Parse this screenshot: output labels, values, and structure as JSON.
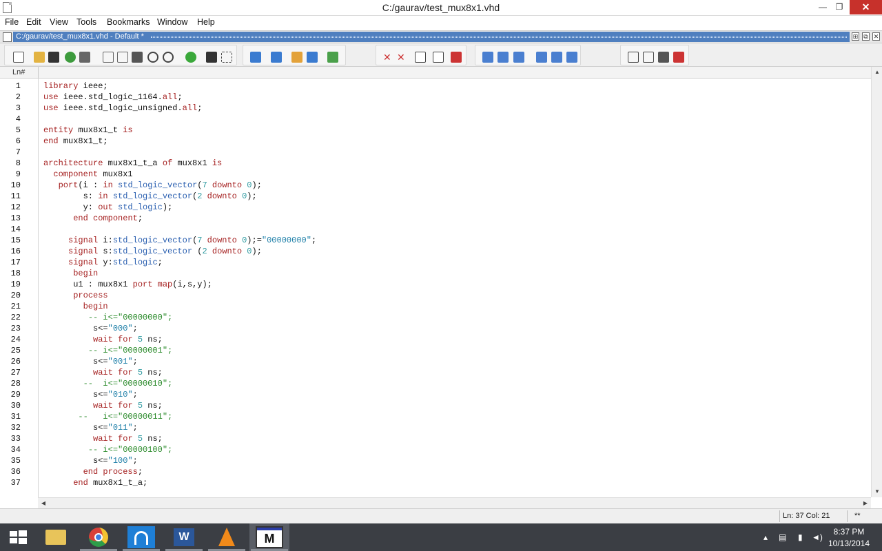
{
  "window": {
    "title": "C:/gaurav/test_mux8x1.vhd",
    "minimize_glyph": "—",
    "maximize_glyph": "❐",
    "close_glyph": "✕"
  },
  "menu": [
    "File",
    "Edit",
    "View",
    "Tools",
    "Bookmarks",
    "Window",
    "Help"
  ],
  "tab": {
    "label": "C:/gaurav/test_mux8x1.vhd - Default *",
    "active_color": "#4f7fbf"
  },
  "ruler": {
    "label": "Ln#"
  },
  "code": [
    {
      "n": "1",
      "seg": [
        [
          "kw",
          "library"
        ],
        [
          "tx",
          " ieee;"
        ]
      ]
    },
    {
      "n": "2",
      "seg": [
        [
          "kw",
          "use"
        ],
        [
          "tx",
          " ieee.std_logic_1164."
        ],
        [
          "kw",
          "all"
        ],
        [
          "tx",
          ";"
        ]
      ]
    },
    {
      "n": "3",
      "seg": [
        [
          "kw",
          "use"
        ],
        [
          "tx",
          " ieee.std_logic_unsigned."
        ],
        [
          "kw",
          "all"
        ],
        [
          "tx",
          ";"
        ]
      ]
    },
    {
      "n": "4",
      "seg": []
    },
    {
      "n": "5",
      "seg": [
        [
          "kw",
          "entity"
        ],
        [
          "tx",
          " mux8x1_t "
        ],
        [
          "kw",
          "is"
        ]
      ]
    },
    {
      "n": "6",
      "seg": [
        [
          "kw",
          "end"
        ],
        [
          "tx",
          " mux8x1_t;"
        ]
      ]
    },
    {
      "n": "7",
      "seg": []
    },
    {
      "n": "8",
      "seg": [
        [
          "kw",
          "architecture"
        ],
        [
          "tx",
          " mux8x1_t_a "
        ],
        [
          "kw",
          "of"
        ],
        [
          "tx",
          " mux8x1 "
        ],
        [
          "kw",
          "is"
        ]
      ]
    },
    {
      "n": "9",
      "seg": [
        [
          "tx",
          "  "
        ],
        [
          "kw",
          "component"
        ],
        [
          "tx",
          " mux8x1"
        ]
      ]
    },
    {
      "n": "10",
      "seg": [
        [
          "tx",
          "   "
        ],
        [
          "kw",
          "port"
        ],
        [
          "tx",
          "(i : "
        ],
        [
          "kw",
          "in"
        ],
        [
          "tx",
          " "
        ],
        [
          "ty",
          "std_logic_vector"
        ],
        [
          "tx",
          "("
        ],
        [
          "nm",
          "7"
        ],
        [
          "tx",
          " "
        ],
        [
          "kw",
          "downto"
        ],
        [
          "tx",
          " "
        ],
        [
          "nm",
          "0"
        ],
        [
          "tx",
          ");"
        ]
      ]
    },
    {
      "n": "11",
      "seg": [
        [
          "tx",
          "        s: "
        ],
        [
          "kw",
          "in"
        ],
        [
          "tx",
          " "
        ],
        [
          "ty",
          "std_logic_vector"
        ],
        [
          "tx",
          "("
        ],
        [
          "nm",
          "2"
        ],
        [
          "tx",
          " "
        ],
        [
          "kw",
          "downto"
        ],
        [
          "tx",
          " "
        ],
        [
          "nm",
          "0"
        ],
        [
          "tx",
          ");"
        ]
      ]
    },
    {
      "n": "12",
      "seg": [
        [
          "tx",
          "        y: "
        ],
        [
          "kw",
          "out"
        ],
        [
          "tx",
          " "
        ],
        [
          "ty",
          "std_logic"
        ],
        [
          "tx",
          ");"
        ]
      ]
    },
    {
      "n": "13",
      "seg": [
        [
          "tx",
          "      "
        ],
        [
          "kw",
          "end"
        ],
        [
          "tx",
          " "
        ],
        [
          "kw",
          "component"
        ],
        [
          "tx",
          ";"
        ]
      ]
    },
    {
      "n": "14",
      "seg": []
    },
    {
      "n": "15",
      "seg": [
        [
          "tx",
          "     "
        ],
        [
          "kw",
          "signal"
        ],
        [
          "tx",
          " i:"
        ],
        [
          "ty",
          "std_logic_vector"
        ],
        [
          "tx",
          "("
        ],
        [
          "nm",
          "7"
        ],
        [
          "tx",
          " "
        ],
        [
          "kw",
          "downto"
        ],
        [
          "tx",
          " "
        ],
        [
          "nm",
          "0"
        ],
        [
          "tx",
          ");="
        ],
        [
          "st",
          "\"00000000\""
        ],
        [
          "tx",
          ";"
        ]
      ]
    },
    {
      "n": "16",
      "seg": [
        [
          "tx",
          "     "
        ],
        [
          "kw",
          "signal"
        ],
        [
          "tx",
          " s:"
        ],
        [
          "ty",
          "std_logic_vector"
        ],
        [
          "tx",
          " ("
        ],
        [
          "nm",
          "2"
        ],
        [
          "tx",
          " "
        ],
        [
          "kw",
          "downto"
        ],
        [
          "tx",
          " "
        ],
        [
          "nm",
          "0"
        ],
        [
          "tx",
          ");"
        ]
      ]
    },
    {
      "n": "17",
      "seg": [
        [
          "tx",
          "     "
        ],
        [
          "kw",
          "signal"
        ],
        [
          "tx",
          " y:"
        ],
        [
          "ty",
          "std_logic"
        ],
        [
          "tx",
          ";"
        ]
      ]
    },
    {
      "n": "18",
      "seg": [
        [
          "tx",
          "      "
        ],
        [
          "kw",
          "begin"
        ]
      ]
    },
    {
      "n": "19",
      "seg": [
        [
          "tx",
          "      u1 : mux8x1 "
        ],
        [
          "kw",
          "port"
        ],
        [
          "tx",
          " "
        ],
        [
          "kw",
          "map"
        ],
        [
          "tx",
          "(i,s,y);"
        ]
      ]
    },
    {
      "n": "20",
      "seg": [
        [
          "tx",
          "      "
        ],
        [
          "kw",
          "process"
        ]
      ]
    },
    {
      "n": "21",
      "seg": [
        [
          "tx",
          "        "
        ],
        [
          "kw",
          "begin"
        ]
      ]
    },
    {
      "n": "22",
      "seg": [
        [
          "tx",
          "         "
        ],
        [
          "cm",
          "-- i<=\"00000000\";"
        ]
      ]
    },
    {
      "n": "23",
      "seg": [
        [
          "tx",
          "          s<="
        ],
        [
          "st",
          "\"000\""
        ],
        [
          "tx",
          ";"
        ]
      ]
    },
    {
      "n": "24",
      "seg": [
        [
          "tx",
          "          "
        ],
        [
          "kw",
          "wait"
        ],
        [
          "tx",
          " "
        ],
        [
          "kw",
          "for"
        ],
        [
          "tx",
          " "
        ],
        [
          "nm",
          "5"
        ],
        [
          "tx",
          " ns;"
        ]
      ]
    },
    {
      "n": "25",
      "seg": [
        [
          "tx",
          "         "
        ],
        [
          "cm",
          "-- i<=\"00000001\";"
        ]
      ]
    },
    {
      "n": "26",
      "seg": [
        [
          "tx",
          "          s<="
        ],
        [
          "st",
          "\"001\""
        ],
        [
          "tx",
          ";"
        ]
      ]
    },
    {
      "n": "27",
      "seg": [
        [
          "tx",
          "          "
        ],
        [
          "kw",
          "wait"
        ],
        [
          "tx",
          " "
        ],
        [
          "kw",
          "for"
        ],
        [
          "tx",
          " "
        ],
        [
          "nm",
          "5"
        ],
        [
          "tx",
          " ns;"
        ]
      ]
    },
    {
      "n": "28",
      "seg": [
        [
          "tx",
          "        "
        ],
        [
          "cm",
          "--  i<=\"00000010\";"
        ]
      ]
    },
    {
      "n": "29",
      "seg": [
        [
          "tx",
          "          s<="
        ],
        [
          "st",
          "\"010\""
        ],
        [
          "tx",
          ";"
        ]
      ]
    },
    {
      "n": "30",
      "seg": [
        [
          "tx",
          "          "
        ],
        [
          "kw",
          "wait"
        ],
        [
          "tx",
          " "
        ],
        [
          "kw",
          "for"
        ],
        [
          "tx",
          " "
        ],
        [
          "nm",
          "5"
        ],
        [
          "tx",
          " ns;"
        ]
      ]
    },
    {
      "n": "31",
      "seg": [
        [
          "tx",
          "       "
        ],
        [
          "cm",
          "--   i<=\"00000011\";"
        ]
      ]
    },
    {
      "n": "32",
      "seg": [
        [
          "tx",
          "          s<="
        ],
        [
          "st",
          "\"011\""
        ],
        [
          "tx",
          ";"
        ]
      ]
    },
    {
      "n": "33",
      "seg": [
        [
          "tx",
          "          "
        ],
        [
          "kw",
          "wait"
        ],
        [
          "tx",
          " "
        ],
        [
          "kw",
          "for"
        ],
        [
          "tx",
          " "
        ],
        [
          "nm",
          "5"
        ],
        [
          "tx",
          " ns;"
        ]
      ]
    },
    {
      "n": "34",
      "seg": [
        [
          "tx",
          "         "
        ],
        [
          "cm",
          "-- i<=\"00000100\";"
        ]
      ]
    },
    {
      "n": "35",
      "seg": [
        [
          "tx",
          "          s<="
        ],
        [
          "st",
          "\"100\""
        ],
        [
          "tx",
          ";"
        ]
      ]
    },
    {
      "n": "36",
      "seg": [
        [
          "tx",
          "        "
        ],
        [
          "kw",
          "end"
        ],
        [
          "tx",
          " "
        ],
        [
          "kw",
          "process"
        ],
        [
          "tx",
          ";"
        ]
      ]
    },
    {
      "n": "37",
      "seg": [
        [
          "tx",
          "      "
        ],
        [
          "kw",
          "end"
        ],
        [
          "tx",
          " mux8x1_t_a;"
        ]
      ]
    }
  ],
  "status": {
    "position": "Ln:  37  Col: 21",
    "modified": "**"
  },
  "taskbar": {
    "apps": [
      "start-icon",
      "file-explorer-icon",
      "chrome-icon",
      "wifi-icon",
      "word-icon",
      "vlc-icon",
      "modelsim-icon"
    ],
    "time": "8:37 PM",
    "date": "10/13/2014"
  },
  "colors": {
    "keyword": "#a52020",
    "type": "#2a5fb0",
    "number": "#2f9aa0",
    "string": "#1e7fa8",
    "comment": "#2a8a2a",
    "taskbar": "#3b3e44"
  }
}
